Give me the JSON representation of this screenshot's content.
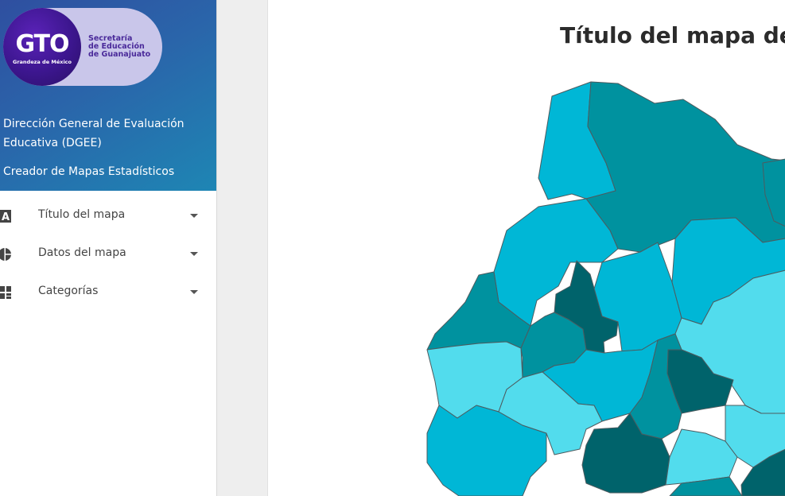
{
  "logo": {
    "brand": "GTO",
    "tagline": "Grandeza de México",
    "org_lines": [
      "Secretaría",
      "de Educación",
      "de Guanajuato"
    ]
  },
  "header": {
    "department": [
      "Dirección General de Evaluación",
      "Educativa (DGEE)"
    ],
    "app_name": "Creador de Mapas Estadísticos"
  },
  "menu": [
    {
      "label": "Título del mapa",
      "icon": "text-a-icon"
    },
    {
      "label": "Datos del mapa",
      "icon": "pie-chart-icon"
    },
    {
      "label": "Categorías",
      "icon": "grid-blocks-icon"
    }
  ],
  "map": {
    "title": "Título del mapa de e",
    "palette": {
      "light": "#52dced",
      "medium": "#00b7d6",
      "dark": "#00929f",
      "darkest": "#00636b",
      "border": "#4d5b5f"
    }
  },
  "colors": {
    "sidebar_gradient_start": "#2f4fa0",
    "sidebar_gradient_end": "#1e86b4",
    "logo_pill": "#c9c6ea",
    "logo_circle": "#3c168e",
    "menu_text": "#444444"
  }
}
